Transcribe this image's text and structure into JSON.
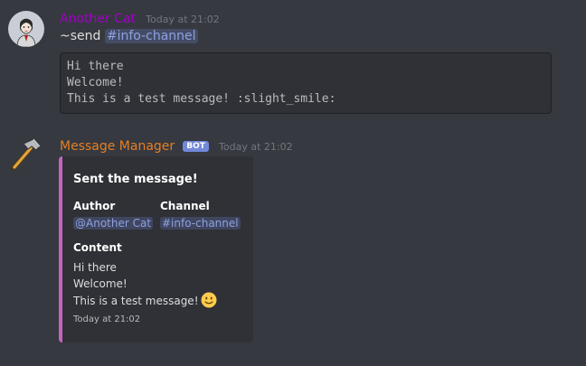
{
  "messages": [
    {
      "author": "Another Cat",
      "author_color": "#a100c8",
      "timestamp": "Today at 21:02",
      "avatar_icon": "person-avatar",
      "command": "~send",
      "channel_mention": "#info-channel",
      "code_lines": [
        "Hi there",
        "Welcome!",
        "This is a test message! :slight_smile:"
      ]
    },
    {
      "author": "Message Manager",
      "author_color": "#e67e22",
      "bot_tag": "BOT",
      "timestamp": "Today at 21:02",
      "avatar_icon": "hammer-icon",
      "embed": {
        "accent_color": "#c565c0",
        "title": "Sent the message!",
        "fields": [
          {
            "name": "Author",
            "value": "@Another Cat"
          },
          {
            "name": "Channel",
            "value": "#info-channel"
          }
        ],
        "content_label": "Content",
        "content_lines": [
          "Hi there",
          "Welcome!",
          "This is a test message!"
        ],
        "content_emoji": "slight-smile-emoji",
        "footer": "Today at 21:02"
      }
    }
  ]
}
